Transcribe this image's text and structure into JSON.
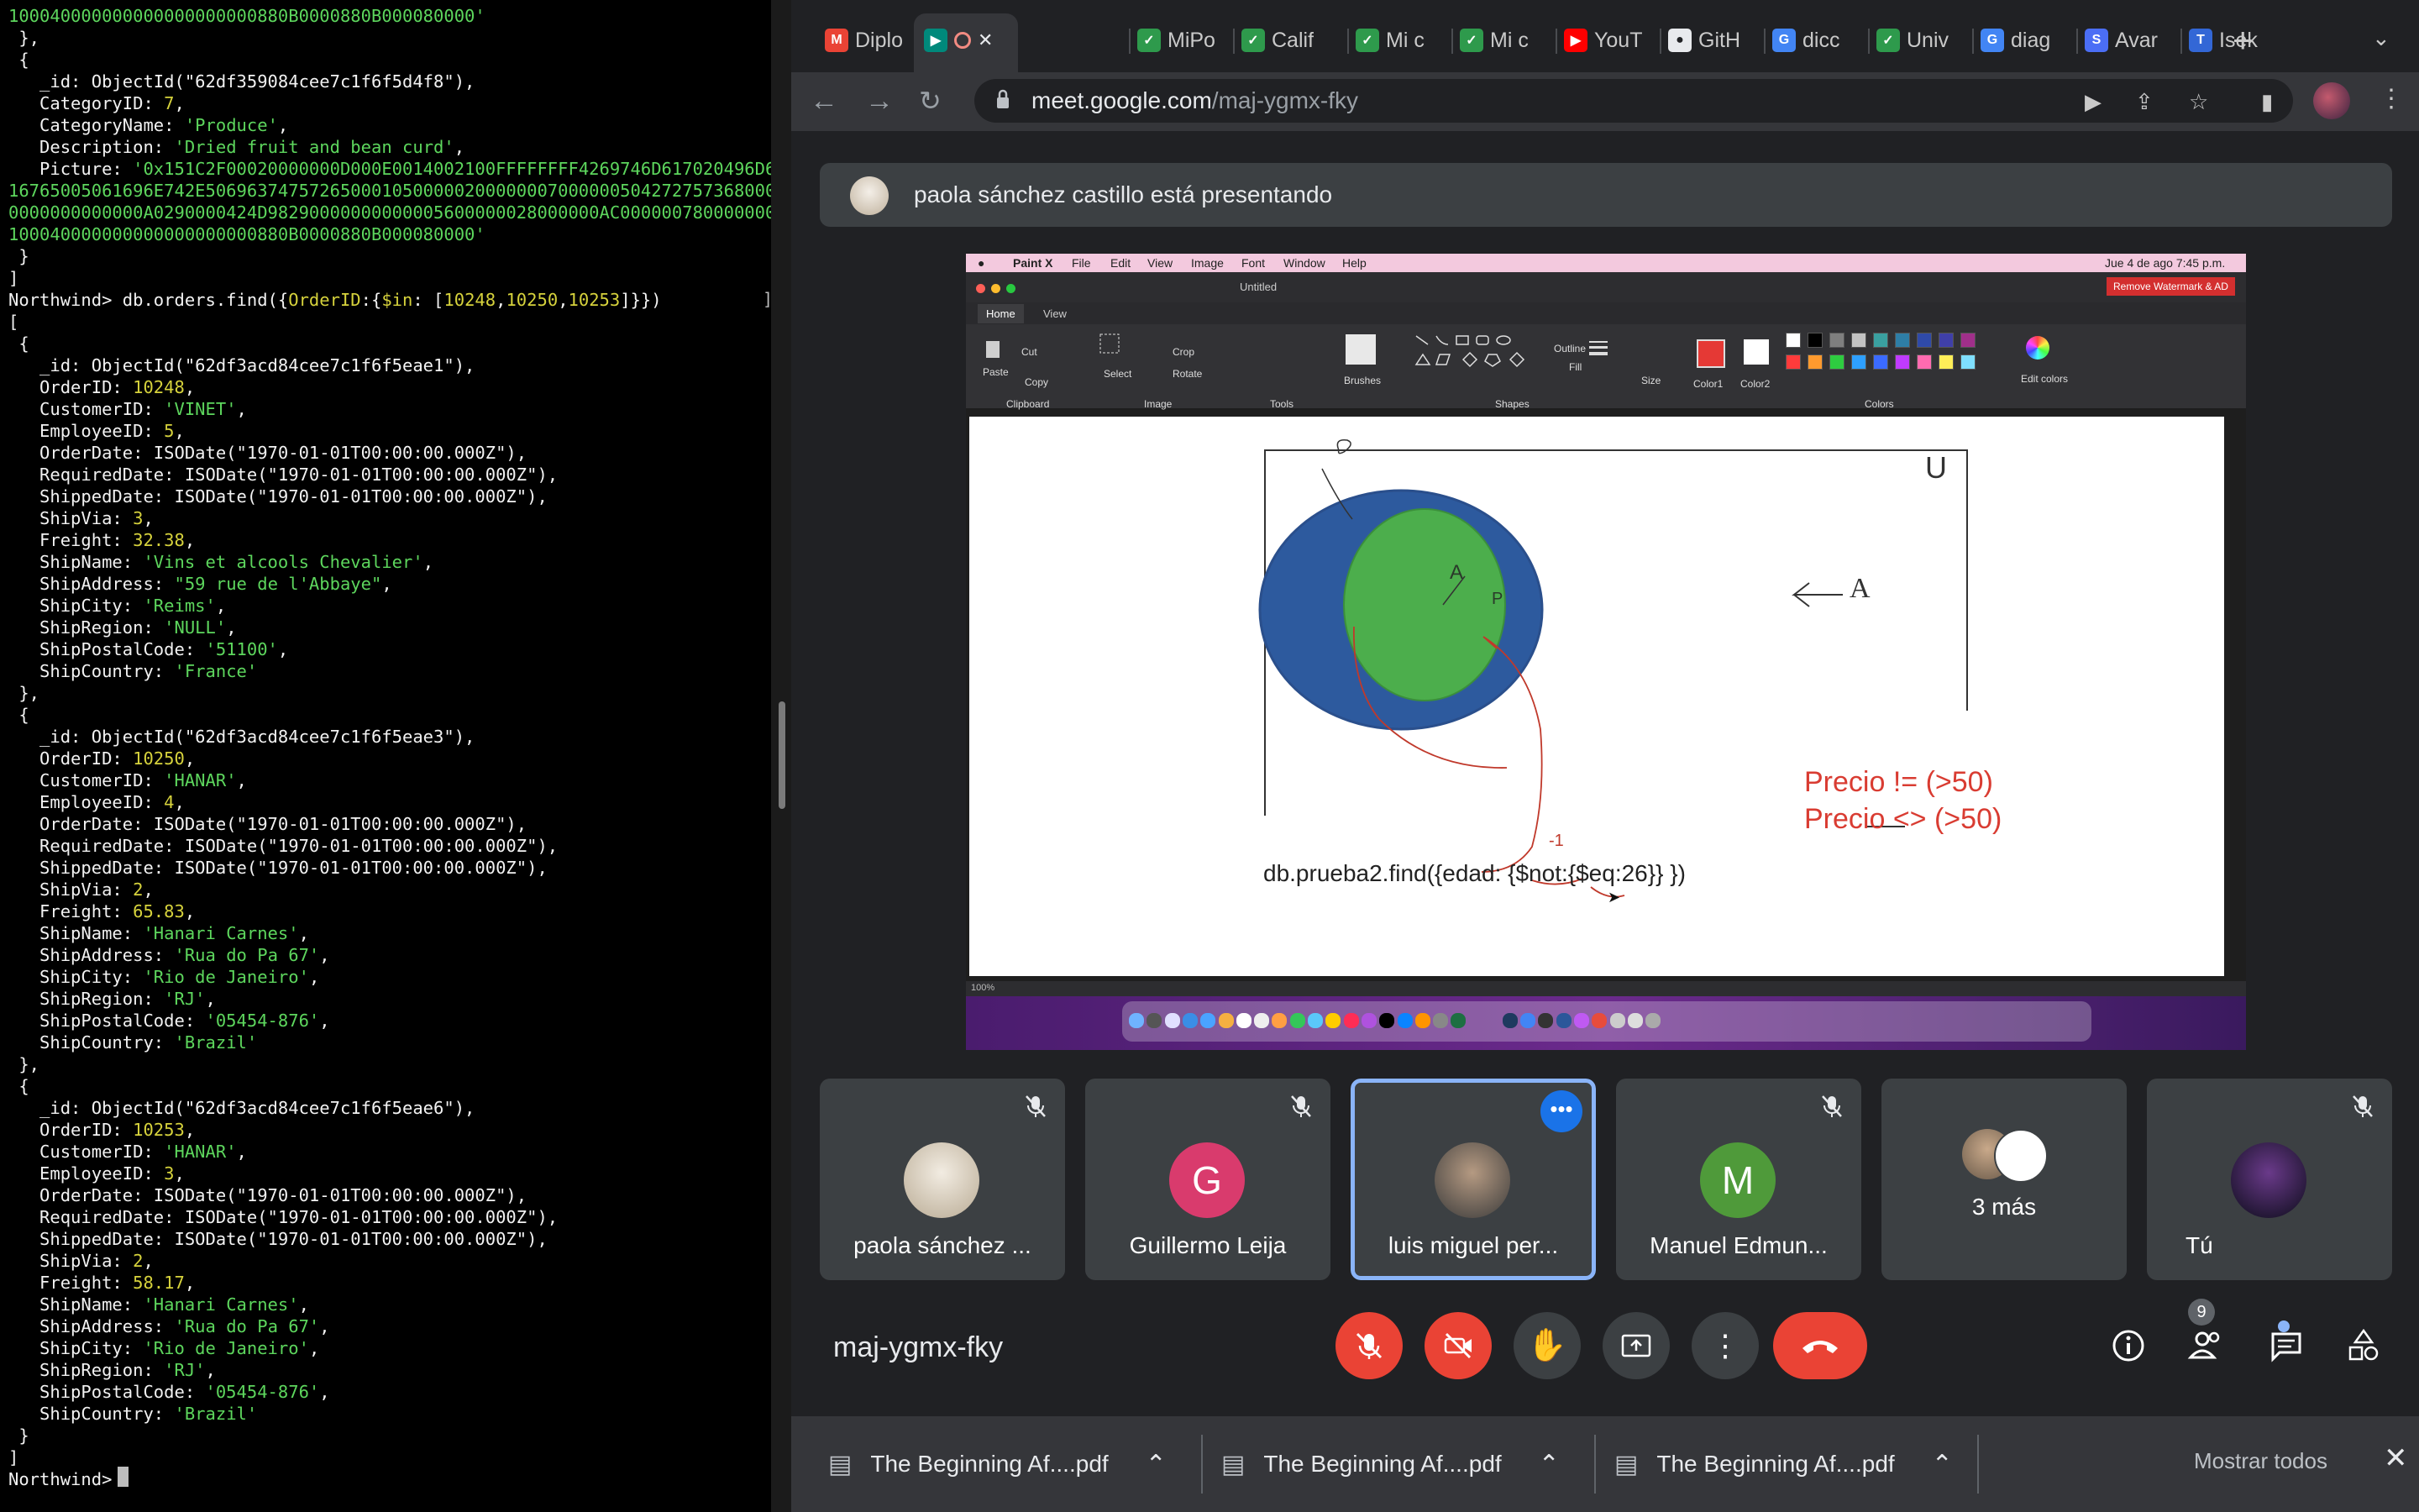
{
  "terminal": {
    "lines": [
      [
        [
          "100040000000000000000000880B0000880B000080000'",
          "g"
        ]
      ],
      [
        [
          " },",
          "w"
        ]
      ],
      [
        [
          " {",
          "w"
        ]
      ],
      [
        [
          "   _id: ObjectId(\"62df359084cee7c1f6f5d4f8\"),",
          "w"
        ]
      ],
      [
        [
          "   CategoryID: ",
          "w"
        ],
        [
          "7",
          "y"
        ],
        [
          ",",
          "w"
        ]
      ],
      [
        [
          "   CategoryName: ",
          "w"
        ],
        [
          "'Produce'",
          "g"
        ],
        [
          ",",
          "w"
        ]
      ],
      [
        [
          "   Description: ",
          "w"
        ],
        [
          "'Dried fruit and bean curd'",
          "g"
        ],
        [
          ",",
          "w"
        ]
      ],
      [
        [
          "   Picture: ",
          "w"
        ],
        [
          "'0x151C2F00020000000D000E0014002100FFFFFFFF4269746D617020496D6",
          "g"
        ]
      ],
      [
        [
          "16765005061696E742E5069637475726500010500000200000007000000504272757368000",
          "g"
        ]
      ],
      [
        [
          "0000000000000A0290000424D98290000000000005600000028000000AC000000780000000",
          "g"
        ]
      ],
      [
        [
          "100040000000000000000000880B0000880B000080000'",
          "g"
        ]
      ],
      [
        [
          " }",
          "w"
        ]
      ],
      [
        [
          "]",
          "w"
        ]
      ],
      [
        [
          "Northwind> db.orders.find({",
          "w"
        ],
        [
          "OrderID",
          "y"
        ],
        [
          ":{",
          "w"
        ],
        [
          "$in",
          "y"
        ],
        [
          ": [",
          "w"
        ],
        [
          "10248",
          "y"
        ],
        [
          ",",
          "w"
        ],
        [
          "10250",
          "y"
        ],
        [
          ",",
          "w"
        ],
        [
          "10253",
          "y"
        ],
        [
          "]}})",
          "w"
        ]
      ],
      [
        [
          "[",
          "w"
        ]
      ],
      [
        [
          " {",
          "w"
        ]
      ],
      [
        [
          "   _id: ObjectId(\"62df3acd84cee7c1f6f5eae1\"),",
          "w"
        ]
      ],
      [
        [
          "   OrderID: ",
          "w"
        ],
        [
          "10248",
          "y"
        ],
        [
          ",",
          "w"
        ]
      ],
      [
        [
          "   CustomerID: ",
          "w"
        ],
        [
          "'VINET'",
          "g"
        ],
        [
          ",",
          "w"
        ]
      ],
      [
        [
          "   EmployeeID: ",
          "w"
        ],
        [
          "5",
          "y"
        ],
        [
          ",",
          "w"
        ]
      ],
      [
        [
          "   OrderDate: ISODate(\"1970-01-01T00:00:00.000Z\"),",
          "w"
        ]
      ],
      [
        [
          "   RequiredDate: ISODate(\"1970-01-01T00:00:00.000Z\"),",
          "w"
        ]
      ],
      [
        [
          "   ShippedDate: ISODate(\"1970-01-01T00:00:00.000Z\"),",
          "w"
        ]
      ],
      [
        [
          "   ShipVia: ",
          "w"
        ],
        [
          "3",
          "y"
        ],
        [
          ",",
          "w"
        ]
      ],
      [
        [
          "   Freight: ",
          "w"
        ],
        [
          "32.38",
          "y"
        ],
        [
          ",",
          "w"
        ]
      ],
      [
        [
          "   ShipName: ",
          "w"
        ],
        [
          "'Vins et alcools Chevalier'",
          "g"
        ],
        [
          ",",
          "w"
        ]
      ],
      [
        [
          "   ShipAddress: ",
          "w"
        ],
        [
          "\"59 rue de l'Abbaye\"",
          "g"
        ],
        [
          ",",
          "w"
        ]
      ],
      [
        [
          "   ShipCity: ",
          "w"
        ],
        [
          "'Reims'",
          "g"
        ],
        [
          ",",
          "w"
        ]
      ],
      [
        [
          "   ShipRegion: ",
          "w"
        ],
        [
          "'NULL'",
          "g"
        ],
        [
          ",",
          "w"
        ]
      ],
      [
        [
          "   ShipPostalCode: ",
          "w"
        ],
        [
          "'51100'",
          "g"
        ],
        [
          ",",
          "w"
        ]
      ],
      [
        [
          "   ShipCountry: ",
          "w"
        ],
        [
          "'France'",
          "g"
        ]
      ],
      [
        [
          " },",
          "w"
        ]
      ],
      [
        [
          " {",
          "w"
        ]
      ],
      [
        [
          "   _id: ObjectId(\"62df3acd84cee7c1f6f5eae3\"),",
          "w"
        ]
      ],
      [
        [
          "   OrderID: ",
          "w"
        ],
        [
          "10250",
          "y"
        ],
        [
          ",",
          "w"
        ]
      ],
      [
        [
          "   CustomerID: ",
          "w"
        ],
        [
          "'HANAR'",
          "g"
        ],
        [
          ",",
          "w"
        ]
      ],
      [
        [
          "   EmployeeID: ",
          "w"
        ],
        [
          "4",
          "y"
        ],
        [
          ",",
          "w"
        ]
      ],
      [
        [
          "   OrderDate: ISODate(\"1970-01-01T00:00:00.000Z\"),",
          "w"
        ]
      ],
      [
        [
          "   RequiredDate: ISODate(\"1970-01-01T00:00:00.000Z\"),",
          "w"
        ]
      ],
      [
        [
          "   ShippedDate: ISODate(\"1970-01-01T00:00:00.000Z\"),",
          "w"
        ]
      ],
      [
        [
          "   ShipVia: ",
          "w"
        ],
        [
          "2",
          "y"
        ],
        [
          ",",
          "w"
        ]
      ],
      [
        [
          "   Freight: ",
          "w"
        ],
        [
          "65.83",
          "y"
        ],
        [
          ",",
          "w"
        ]
      ],
      [
        [
          "   ShipName: ",
          "w"
        ],
        [
          "'Hanari Carnes'",
          "g"
        ],
        [
          ",",
          "w"
        ]
      ],
      [
        [
          "   ShipAddress: ",
          "w"
        ],
        [
          "'Rua do Pa 67'",
          "g"
        ],
        [
          ",",
          "w"
        ]
      ],
      [
        [
          "   ShipCity: ",
          "w"
        ],
        [
          "'Rio de Janeiro'",
          "g"
        ],
        [
          ",",
          "w"
        ]
      ],
      [
        [
          "   ShipRegion: ",
          "w"
        ],
        [
          "'RJ'",
          "g"
        ],
        [
          ",",
          "w"
        ]
      ],
      [
        [
          "   ShipPostalCode: ",
          "w"
        ],
        [
          "'05454-876'",
          "g"
        ],
        [
          ",",
          "w"
        ]
      ],
      [
        [
          "   ShipCountry: ",
          "w"
        ],
        [
          "'Brazil'",
          "g"
        ]
      ],
      [
        [
          " },",
          "w"
        ]
      ],
      [
        [
          " {",
          "w"
        ]
      ],
      [
        [
          "   _id: ObjectId(\"62df3acd84cee7c1f6f5eae6\"),",
          "w"
        ]
      ],
      [
        [
          "   OrderID: ",
          "w"
        ],
        [
          "10253",
          "y"
        ],
        [
          ",",
          "w"
        ]
      ],
      [
        [
          "   CustomerID: ",
          "w"
        ],
        [
          "'HANAR'",
          "g"
        ],
        [
          ",",
          "w"
        ]
      ],
      [
        [
          "   EmployeeID: ",
          "w"
        ],
        [
          "3",
          "y"
        ],
        [
          ",",
          "w"
        ]
      ],
      [
        [
          "   OrderDate: ISODate(\"1970-01-01T00:00:00.000Z\"),",
          "w"
        ]
      ],
      [
        [
          "   RequiredDate: ISODate(\"1970-01-01T00:00:00.000Z\"),",
          "w"
        ]
      ],
      [
        [
          "   ShippedDate: ISODate(\"1970-01-01T00:00:00.000Z\"),",
          "w"
        ]
      ],
      [
        [
          "   ShipVia: ",
          "w"
        ],
        [
          "2",
          "y"
        ],
        [
          ",",
          "w"
        ]
      ],
      [
        [
          "   Freight: ",
          "w"
        ],
        [
          "58.17",
          "y"
        ],
        [
          ",",
          "w"
        ]
      ],
      [
        [
          "   ShipName: ",
          "w"
        ],
        [
          "'Hanari Carnes'",
          "g"
        ],
        [
          ",",
          "w"
        ]
      ],
      [
        [
          "   ShipAddress: ",
          "w"
        ],
        [
          "'Rua do Pa 67'",
          "g"
        ],
        [
          ",",
          "w"
        ]
      ],
      [
        [
          "   ShipCity: ",
          "w"
        ],
        [
          "'Rio de Janeiro'",
          "g"
        ],
        [
          ",",
          "w"
        ]
      ],
      [
        [
          "   ShipRegion: ",
          "w"
        ],
        [
          "'RJ'",
          "g"
        ],
        [
          ",",
          "w"
        ]
      ],
      [
        [
          "   ShipPostalCode: ",
          "w"
        ],
        [
          "'05454-876'",
          "g"
        ],
        [
          ",",
          "w"
        ]
      ],
      [
        [
          "   ShipCountry: ",
          "w"
        ],
        [
          "'Brazil'",
          "g"
        ]
      ],
      [
        [
          " }",
          "w"
        ]
      ],
      [
        [
          "]",
          "w"
        ]
      ],
      [
        [
          "Northwind> ",
          "w"
        ]
      ]
    ],
    "bracket": "]"
  },
  "browser": {
    "tabs": [
      {
        "label": "Diplo",
        "icon": "gmail-icon"
      },
      {
        "label": "",
        "icon": "meet-icon",
        "active": true
      },
      {
        "label": "MiPo",
        "icon": "leaf-icon"
      },
      {
        "label": "Calif",
        "icon": "leaf-icon"
      },
      {
        "label": "Mi c",
        "icon": "leaf-icon"
      },
      {
        "label": "Mi c",
        "icon": "leaf-icon"
      },
      {
        "label": "YouT",
        "icon": "youtube-icon"
      },
      {
        "label": "GitH",
        "icon": "github-icon"
      },
      {
        "label": "dicc",
        "icon": "google-icon"
      },
      {
        "label": "Univ",
        "icon": "leaf-icon"
      },
      {
        "label": "diag",
        "icon": "google-icon"
      },
      {
        "label": "Avar",
        "icon": "s-icon"
      },
      {
        "label": "Isek",
        "icon": "tmo-icon"
      }
    ],
    "new_tab": "+",
    "url_host": "meet.google.com",
    "url_path": "/maj-ygmx-fky"
  },
  "meet": {
    "presenting_text": "paola sánchez castillo está presentando",
    "meeting_code": "maj-ygmx-fky",
    "people_count": "9",
    "participants": [
      {
        "name": "paola sánchez ...",
        "initial": "",
        "color": "#e9e2d6",
        "muted": true
      },
      {
        "name": "Guillermo Leija",
        "initial": "G",
        "color": "#d93b6d",
        "muted": true
      },
      {
        "name": "luis miguel per...",
        "initial": "",
        "color": "#777777",
        "muted": false,
        "speaking": true
      },
      {
        "name": "Manuel Edmun...",
        "initial": "M",
        "color": "#4f9a3a",
        "muted": true
      },
      {
        "name": "3 más",
        "initial": "",
        "color": "",
        "muted": false
      },
      {
        "name": "Tú",
        "initial": "",
        "color": "#2a1a40",
        "muted": true
      }
    ]
  },
  "shared": {
    "menubar": {
      "app": "Paint X",
      "items": [
        "File",
        "Edit",
        "View",
        "Image",
        "Font",
        "Window",
        "Help"
      ],
      "clock": "Jue 4 de ago  7:45 p.m."
    },
    "window_title": "Untitled",
    "remove_watermark": "Remove Watermark & AD",
    "tabs": [
      "Home",
      "View"
    ],
    "ribbon": {
      "paste": "Paste",
      "cut": "Cut",
      "copy": "Copy",
      "select": "Select",
      "crop": "Crop",
      "rotate": "Rotate",
      "brushes": "Brushes",
      "outline": "Outline",
      "fill": "Fill",
      "size": "Size",
      "color1": "Color1",
      "color2": "Color2",
      "edit_colors": "Edit colors",
      "group_clipboard": "Clipboard",
      "group_image": "Image",
      "group_tools": "Tools",
      "group_shapes": "Shapes",
      "group_colors": "Colors"
    },
    "palette": [
      "#ffffff",
      "#000000",
      "#7f7f7f",
      "#c3c3c3",
      "#3aa0a0",
      "#2e7ea6",
      "#2f4aa8",
      "#3f3fa8",
      "#a02f8a",
      "#ff3b3b",
      "#ff9a2e",
      "#2ecc40",
      "#2ea0ff",
      "#3b6bff",
      "#c03bff",
      "#ff6bb0",
      "#ffee58",
      "#7fdfff"
    ],
    "color1": "#e53935",
    "color2": "#ffffff",
    "drawing": {
      "label_a1": "A",
      "label_a2": "A",
      "label_p": "P",
      "label_u": "U",
      "label_minus1": "-1",
      "red_line1": "Precio != (>50)",
      "red_line2": "Precio <> (>50)",
      "query": "db.prueba2.find({edad: {$not:{$eq:26}} })"
    },
    "zoom": "100%"
  },
  "downloads": {
    "items": [
      "The Beginning Af....pdf",
      "The Beginning Af....pdf",
      "The Beginning Af....pdf"
    ],
    "show_all": "Mostrar todos"
  }
}
